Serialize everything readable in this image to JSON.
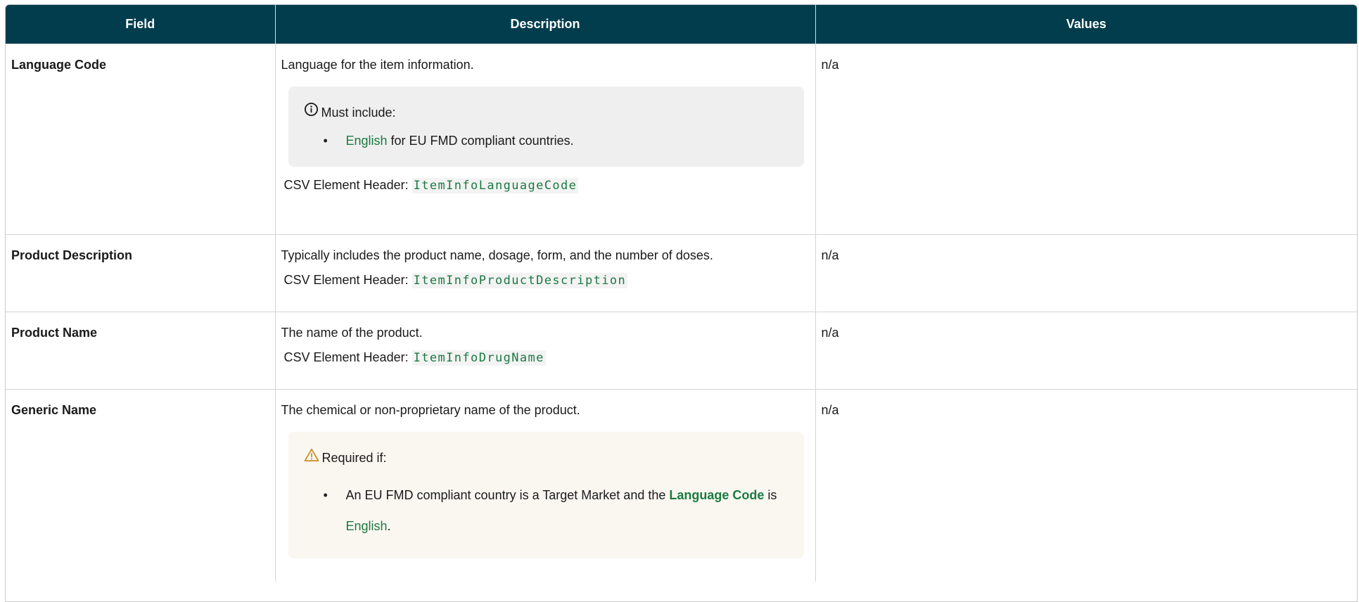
{
  "headers": {
    "field": "Field",
    "description": "Description",
    "values": "Values"
  },
  "rows": [
    {
      "field": "Language Code",
      "description": "Language for the item information.",
      "callout": {
        "type": "info",
        "icon": "info-circle-icon",
        "heading": "Must include:",
        "items": [
          {
            "link": "English",
            "rest": " for EU FMD compliant countries."
          }
        ]
      },
      "csv_label": "CSV Element Header:",
      "csv_code": "ItemInfoLanguageCode",
      "value": "n/a"
    },
    {
      "field": "Product Description",
      "description": "Typically includes the product name, dosage, form, and the number of doses.",
      "csv_label": "CSV Element Header:",
      "csv_code": "ItemInfoProductDescription",
      "value": "n/a"
    },
    {
      "field": "Product Name",
      "description": "The name of the product.",
      "csv_label": "CSV Element Header:",
      "csv_code": "ItemInfoDrugName",
      "value": "n/a"
    },
    {
      "field": "Generic Name",
      "description": "The chemical or non-proprietary name of the product.",
      "callout": {
        "type": "warning",
        "icon": "warning-triangle-icon",
        "heading": "Required if:",
        "items": [
          {
            "text_before": "An EU FMD compliant country is a Target Market and the ",
            "bold_link": "Language Code",
            "text_mid": " is ",
            "link": "English",
            "text_after": "."
          }
        ]
      },
      "value": "n/a"
    }
  ],
  "colors": {
    "header_bg": "#013d4d",
    "link": "#1b7a42",
    "info_bg": "#efefef",
    "warning_bg": "#faf7f1",
    "warning_icon": "#c8922a"
  }
}
